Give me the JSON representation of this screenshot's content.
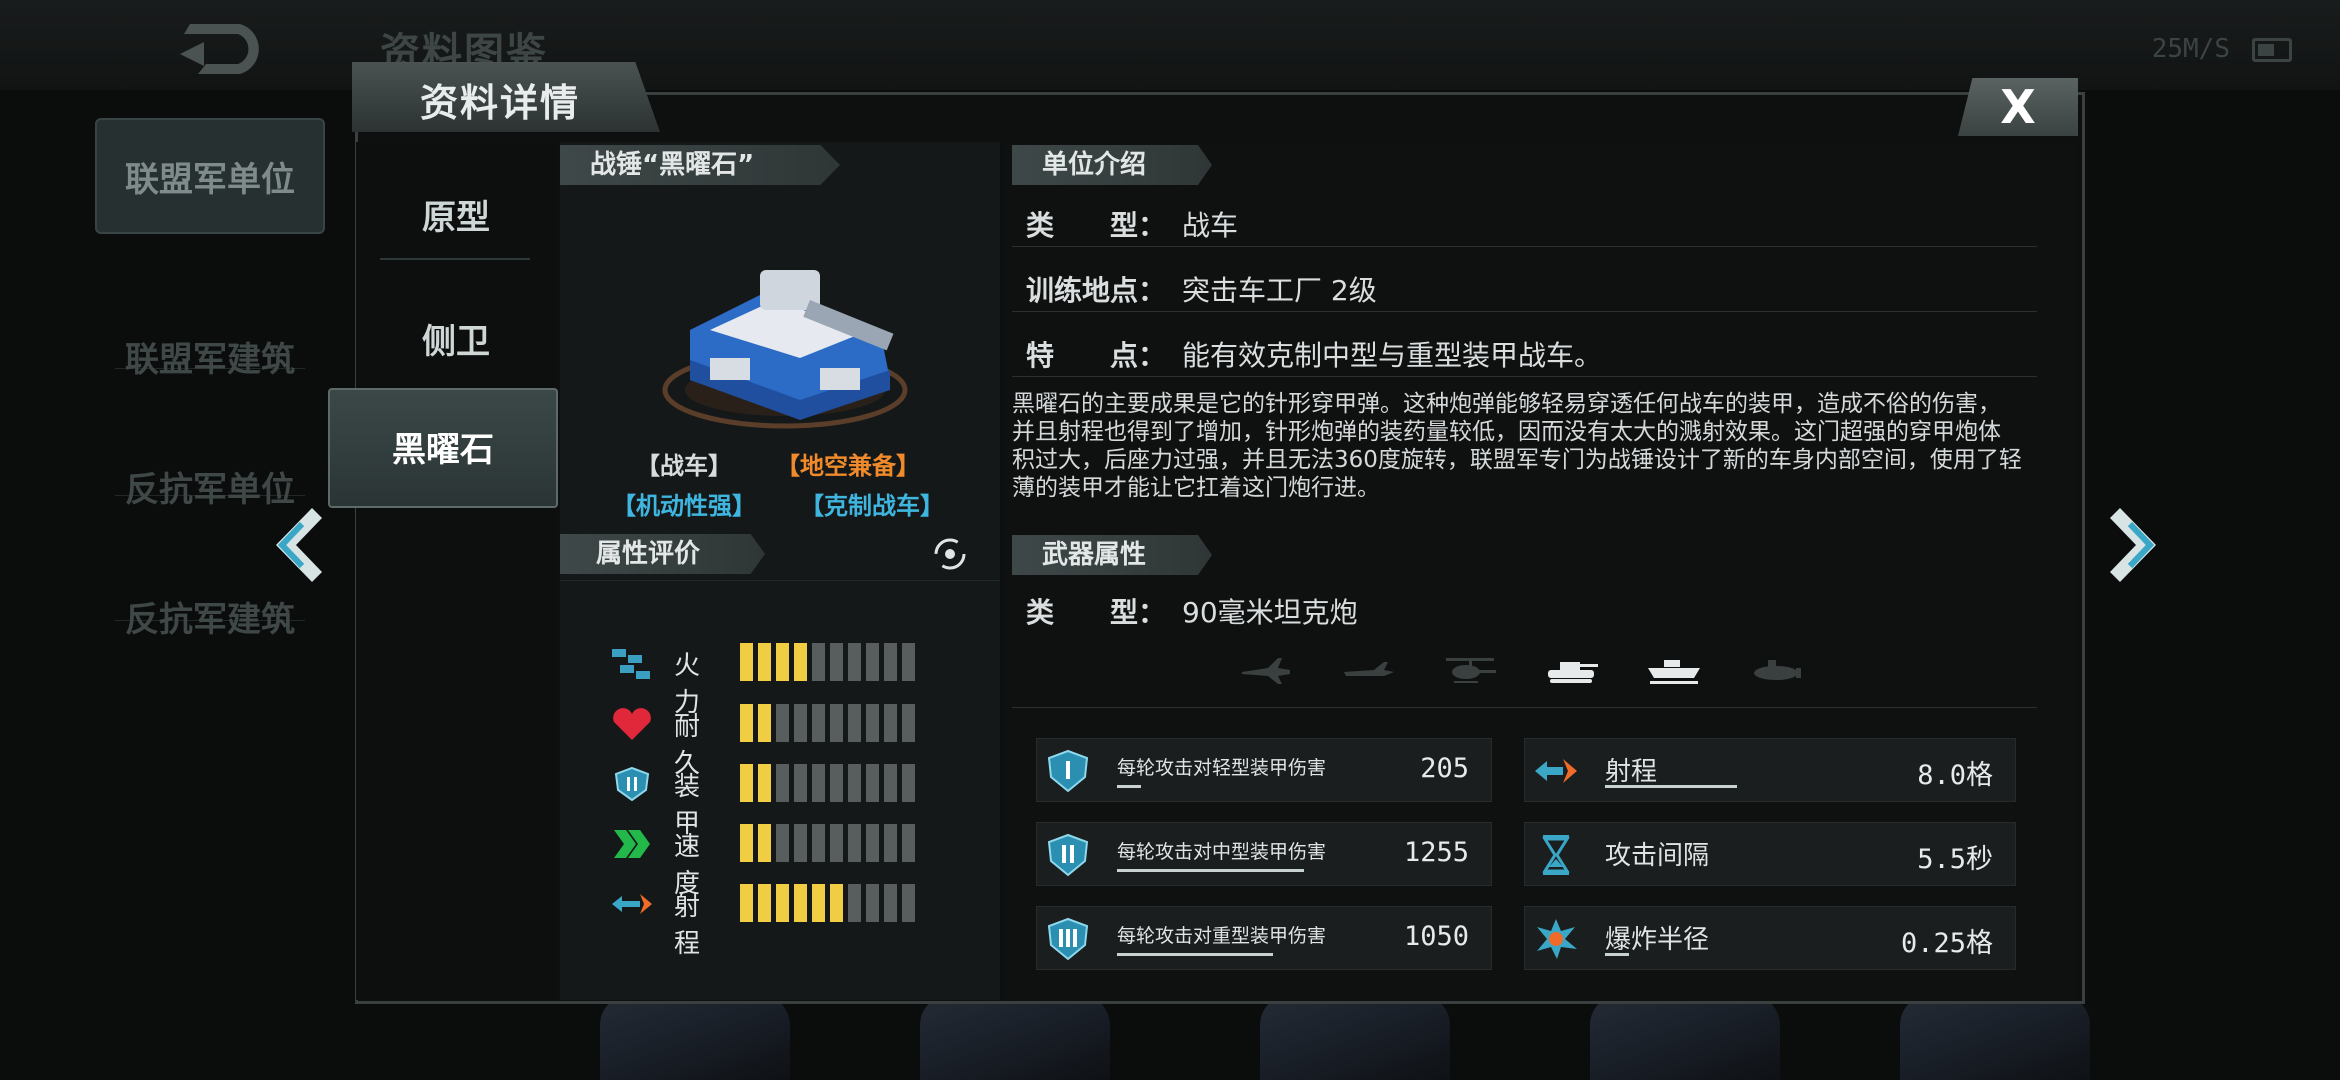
{
  "status_bar": {
    "network_speed": "25M/S"
  },
  "background": {
    "title": "资料图鉴",
    "categories": [
      "联盟军单位",
      "联盟军建筑",
      "反抗军单位",
      "反抗军建筑"
    ]
  },
  "dialog": {
    "title": "资料详情",
    "close_label": "X",
    "tabs": [
      "原型",
      "侧卫",
      "黑曜石"
    ],
    "active_tab": "黑曜石"
  },
  "unit": {
    "name": "战锤“黑曜石”",
    "tags": [
      {
        "text": "【战车】",
        "color": "#ffffff"
      },
      {
        "text": "【地空兼备】",
        "color": "#f08a2a"
      },
      {
        "text": "【机动性强】",
        "color": "#3fb6e0"
      },
      {
        "text": "【克制战车】",
        "color": "#3fb6e0"
      }
    ]
  },
  "attributes": {
    "header": "属性评价",
    "max": 10,
    "items": [
      {
        "label": "火力",
        "value": 4,
        "icon": "firepower-icon"
      },
      {
        "label": "耐久",
        "value": 2,
        "icon": "heart-icon"
      },
      {
        "label": "装甲",
        "value": 2,
        "icon": "armor-shield-icon"
      },
      {
        "label": "速度",
        "value": 2,
        "icon": "speed-chevron-icon"
      },
      {
        "label": "射程",
        "value": 6,
        "icon": "range-arrow-icon"
      }
    ]
  },
  "intro": {
    "header": "单位介绍",
    "rows": [
      {
        "key": "类　　型：",
        "value": "战车"
      },
      {
        "key": "训练地点：",
        "value": "突击车工厂 2级"
      },
      {
        "key": "特　　点：",
        "value": "能有效克制中型与重型装甲战车。"
      }
    ],
    "description": "黑曜石的主要成果是它的针形穿甲弹。这种炮弹能够轻易穿透任何战车的装甲，造成不俗的伤害，并且射程也得到了增加，针形炮弹的装药量较低，因而没有太大的溅射效果。这门超强的穿甲炮体积过大，后座力过强，并且无法360度旋转，联盟军专门为战锤设计了新的车身内部空间，使用了轻薄的装甲才能让它扛着这门炮行进。"
  },
  "weapon": {
    "header": "武器属性",
    "type_key": "类　　型：",
    "type_value": "90毫米坦克炮",
    "targets": [
      {
        "icon": "jet-icon",
        "active": false
      },
      {
        "icon": "plane-icon",
        "active": false
      },
      {
        "icon": "helicopter-icon",
        "active": false
      },
      {
        "icon": "tank-icon",
        "active": true
      },
      {
        "icon": "ship-icon",
        "active": true
      },
      {
        "icon": "submarine-icon",
        "active": false
      }
    ],
    "damage_stats": [
      {
        "label": "每轮攻击对轻型装甲伤害",
        "value": "205",
        "icon": "light-armor-icon",
        "fill": 0.15
      },
      {
        "label": "每轮攻击对中型装甲伤害",
        "value": "1255",
        "icon": "medium-armor-icon",
        "fill": 0.9
      },
      {
        "label": "每轮攻击对重型装甲伤害",
        "value": "1050",
        "icon": "heavy-armor-icon",
        "fill": 0.75
      }
    ],
    "other_stats": [
      {
        "label": "射程",
        "value": "8.0格",
        "icon": "range-icon",
        "fill": 0.55
      },
      {
        "label": "攻击间隔",
        "value": "5.5秒",
        "icon": "hourglass-icon",
        "fill": 0.0
      },
      {
        "label": "爆炸半径",
        "value": "0.25格",
        "icon": "blast-radius-icon",
        "fill": 0.1
      }
    ]
  }
}
